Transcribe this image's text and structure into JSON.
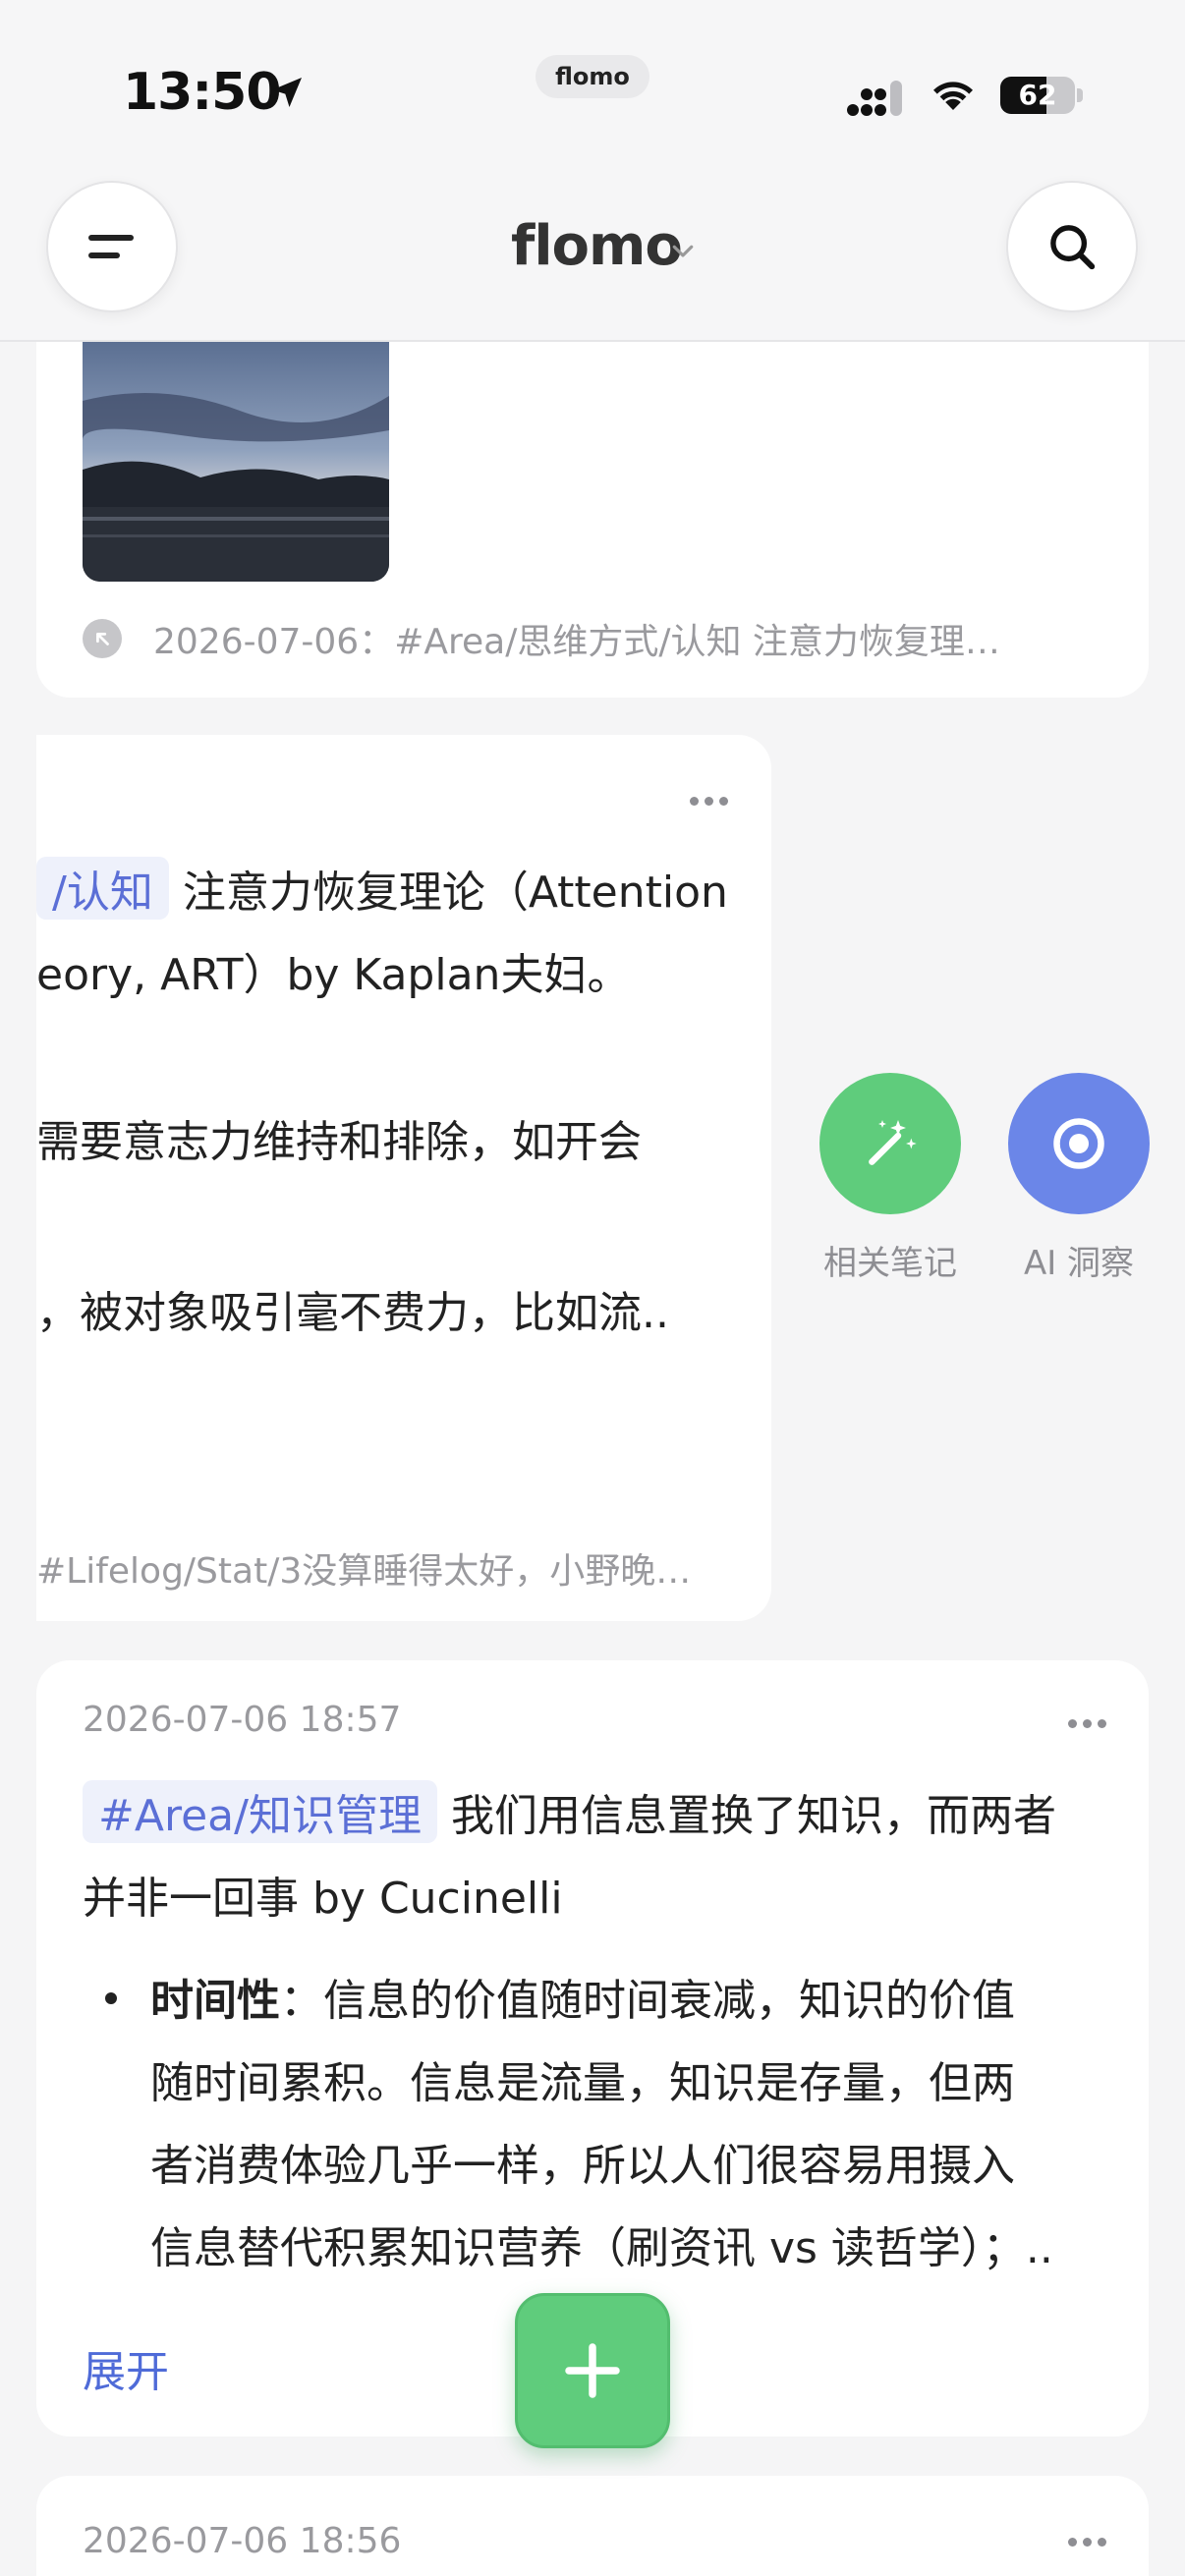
{
  "status_bar": {
    "time": "13:50",
    "island_label": "flomo",
    "battery": "62",
    "battery_level": 0.62
  },
  "header": {
    "title": "flomo"
  },
  "card1": {
    "ref_text": "2026-07-06：#Area/思维方式/认知 注意力恢复理…"
  },
  "card2": {
    "tag": "/认知",
    "line1_rest": " 注意力恢复理论（Attention",
    "line2": "eory, ART）by Kaplan夫妇。",
    "line3": " 需要意志力维持和排除，如开会",
    "line4": "，被对象吸引毫不费力，比如流..",
    "footer": "#Lifelog/Stat/3没算睡得太好，小野晚…"
  },
  "actions": {
    "related_label": "相关笔记",
    "ai_label": "AI 洞察"
  },
  "card3": {
    "date": "2026-07-06 18:57",
    "tag": "#Area/知识管理",
    "line1_rest": " 我们用信息置换了知识，而两者",
    "line2": "并非一回事 by Cucinelli",
    "bullet_bold": "时间性",
    "bullet_line1_rest": "：信息的价值随时间衰减，知识的价值",
    "bullet_line2": "随时间累积。信息是流量，知识是存量，但两",
    "bullet_line3": "者消费体验几乎一样，所以人们很容易用摄入",
    "bullet_line4": "信息替代积累知识营养（刷资讯 vs 读哲学）；..",
    "expand": "展开"
  },
  "card4": {
    "date": "2026-07-06 18:56"
  },
  "colors": {
    "accent_green": "#5fcc7c",
    "accent_blue": "#6b86e8",
    "tag_blue": "#5b6fd6",
    "link_blue": "#4f6bd8"
  },
  "icons": [
    "location-arrow-icon",
    "cellular-signal-icon",
    "wifi-icon",
    "battery-icon",
    "menu-icon",
    "chevron-down-icon",
    "search-icon",
    "reference-arrow-icon",
    "more-icon",
    "magic-wand-icon",
    "ai-insight-icon",
    "plus-icon"
  ]
}
